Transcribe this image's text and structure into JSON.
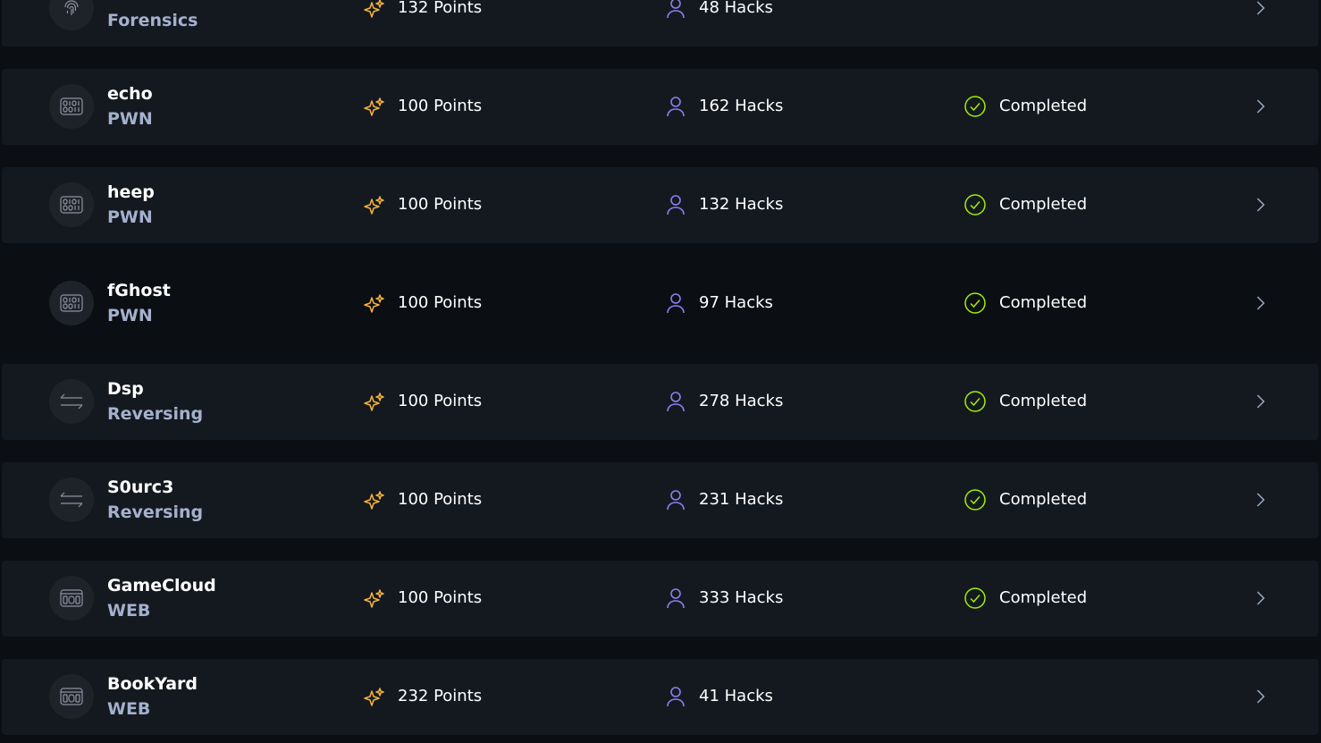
{
  "colors": {
    "background": "#0b0e13",
    "row": "#141920",
    "points_icon": "#f7b33a",
    "hacks_icon": "#8c7ff0",
    "completed_icon": "#9fef00",
    "category_text": "#a4b1cd"
  },
  "challenges": [
    {
      "name": "",
      "category": "Forensics",
      "icon": "fingerprint-icon",
      "points": "132 Points",
      "hacks": "48 Hacks",
      "status": ""
    },
    {
      "name": "echo",
      "category": "PWN",
      "icon": "binary-icon",
      "points": "100 Points",
      "hacks": "162 Hacks",
      "status": "Completed"
    },
    {
      "name": "heep",
      "category": "PWN",
      "icon": "binary-icon",
      "points": "100 Points",
      "hacks": "132 Hacks",
      "status": "Completed"
    },
    {
      "name": "fGhost",
      "category": "PWN",
      "icon": "binary-icon",
      "points": "100 Points",
      "hacks": "97 Hacks",
      "status": "Completed"
    },
    {
      "name": "Dsp",
      "category": "Reversing",
      "icon": "arrows-icon",
      "points": "100 Points",
      "hacks": "278 Hacks",
      "status": "Completed"
    },
    {
      "name": "S0urc3",
      "category": "Reversing",
      "icon": "arrows-icon",
      "points": "100 Points",
      "hacks": "231 Hacks",
      "status": "Completed"
    },
    {
      "name": "GameCloud",
      "category": "WEB",
      "icon": "browser-icon",
      "points": "100 Points",
      "hacks": "333 Hacks",
      "status": "Completed"
    },
    {
      "name": "BookYard",
      "category": "WEB",
      "icon": "browser-icon",
      "points": "232 Points",
      "hacks": "41 Hacks",
      "status": ""
    }
  ]
}
